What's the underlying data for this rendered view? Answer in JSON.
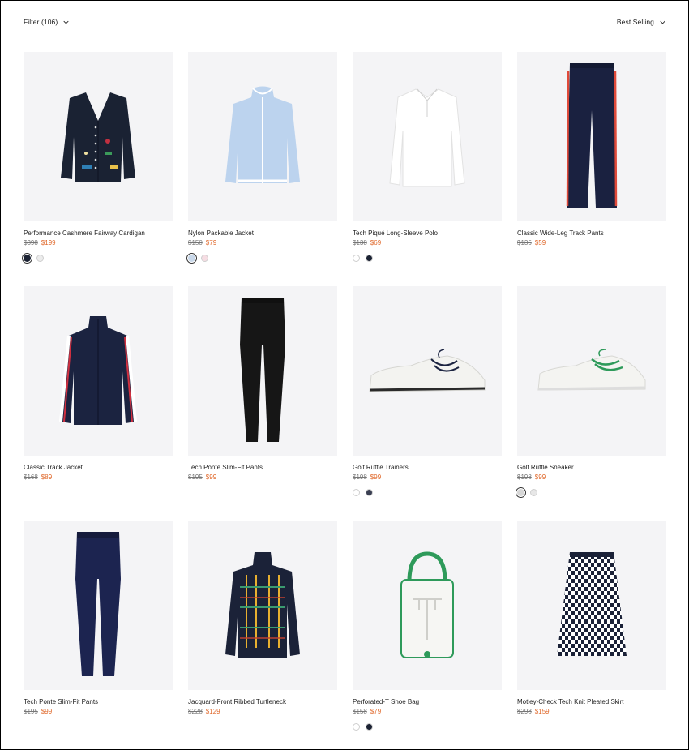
{
  "toolbar": {
    "filter_label": "Filter (106)",
    "sort_label": "Best Selling"
  },
  "products": [
    {
      "name": "Performance Cashmere Fairway Cardigan",
      "old_price": "$398",
      "price": "$199",
      "swatches": [
        {
          "color": "#1b2233",
          "selected": true
        },
        {
          "color": "#ececec",
          "selected": false
        }
      ]
    },
    {
      "name": "Nylon Packable Jacket",
      "old_price": "$150",
      "price": "$79",
      "swatches": [
        {
          "color": "#c9d8ea",
          "selected": true
        },
        {
          "color": "#f6dde3",
          "selected": false
        }
      ]
    },
    {
      "name": "Tech Piqué Long-Sleeve Polo",
      "old_price": "$138",
      "price": "$69",
      "swatches": [
        {
          "color": "#ffffff",
          "selected": false
        },
        {
          "color": "#1b2233",
          "selected": false
        }
      ]
    },
    {
      "name": "Classic Wide-Leg Track Pants",
      "old_price": "$135",
      "price": "$59",
      "swatches": []
    },
    {
      "name": "Classic Track Jacket",
      "old_price": "$168",
      "price": "$89",
      "swatches": []
    },
    {
      "name": "Tech Ponte Slim-Fit Pants",
      "old_price": "$195",
      "price": "$99",
      "swatches": []
    },
    {
      "name": "Golf Ruffle Trainers",
      "old_price": "$198",
      "price": "$99",
      "swatches": [
        {
          "color": "#ffffff",
          "selected": false
        },
        {
          "color": "#3a3f52",
          "selected": false
        }
      ]
    },
    {
      "name": "Golf Ruffle Sneaker",
      "old_price": "$198",
      "price": "$99",
      "swatches": [
        {
          "color": "#d6d6d6",
          "selected": true
        },
        {
          "color": "#e7e7e7",
          "selected": false
        }
      ]
    },
    {
      "name": "Tech Ponte Slim-Fit Pants",
      "old_price": "$195",
      "price": "$99",
      "swatches": []
    },
    {
      "name": "Jacquard-Front Ribbed Turtleneck",
      "old_price": "$228",
      "price": "$129",
      "swatches": []
    },
    {
      "name": "Perforated-T Shoe Bag",
      "old_price": "$158",
      "price": "$79",
      "swatches": [
        {
          "color": "#ffffff",
          "selected": false
        },
        {
          "color": "#1b2233",
          "selected": false
        }
      ]
    },
    {
      "name": "Motley-Check Tech Knit Pleated Skirt",
      "old_price": "$298",
      "price": "$159",
      "swatches": []
    }
  ],
  "product_images": [
    "cardigan-icon",
    "jacket-icon",
    "polo-icon",
    "track-pants-icon",
    "track-jacket-icon",
    "leggings-icon",
    "trainer-icon",
    "sneaker-icon",
    "leggings-icon",
    "turtleneck-icon",
    "shoe-bag-icon",
    "skirt-icon"
  ]
}
